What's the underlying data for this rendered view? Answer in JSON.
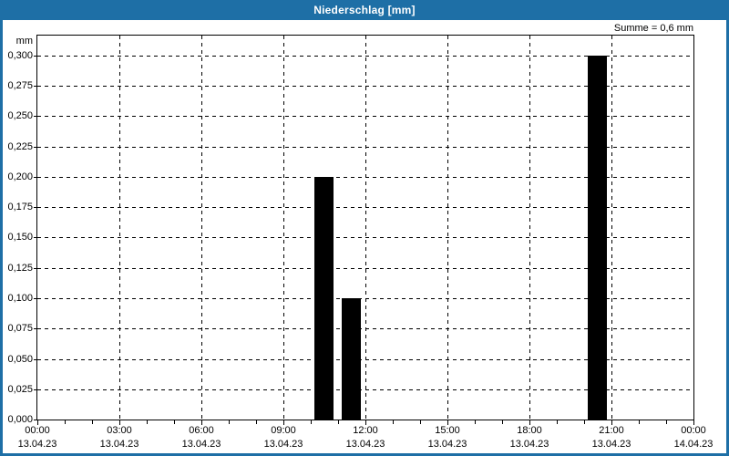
{
  "window": {
    "title": "Niederschlag [mm]"
  },
  "colors": {
    "titlebar": "#1e6fa6",
    "frame": "#1e6fa6",
    "plot_border": "#000000",
    "background": "#ffffff",
    "bar": "#000000",
    "title_text": "#ffffff"
  },
  "chart_data": {
    "type": "bar",
    "title": "Niederschlag [mm]",
    "ylabel": "mm",
    "xlabel": "",
    "sum_annotation": "Summe = 0,6 mm",
    "ylim": [
      0,
      0.3
    ],
    "ytick_step": 0.025,
    "ytick_labels": [
      "0,000",
      "0,025",
      "0,050",
      "0,075",
      "0,100",
      "0,125",
      "0,150",
      "0,175",
      "0,200",
      "0,225",
      "0,250",
      "0,275",
      "0,300"
    ],
    "x_range_hours": [
      0,
      24
    ],
    "xtick_hours": [
      0,
      3,
      6,
      9,
      12,
      15,
      18,
      21,
      24
    ],
    "xticks": [
      {
        "time": "00:00",
        "date": "13.04.23"
      },
      {
        "time": "03:00",
        "date": "13.04.23"
      },
      {
        "time": "06:00",
        "date": "13.04.23"
      },
      {
        "time": "09:00",
        "date": "13.04.23"
      },
      {
        "time": "12:00",
        "date": "13.04.23"
      },
      {
        "time": "15:00",
        "date": "13.04.23"
      },
      {
        "time": "18:00",
        "date": "13.04.23"
      },
      {
        "time": "21:00",
        "date": "13.04.23"
      },
      {
        "time": "00:00",
        "date": "14.04.23"
      }
    ],
    "minor_xtick_every_hours": 1,
    "grid": "dashed",
    "legend": null,
    "series": [
      {
        "name": "Niederschlag",
        "unit": "mm",
        "bars": [
          {
            "interval": "10:00-11:00",
            "start_hour": 10,
            "end_hour": 11,
            "value_mm": 0.2
          },
          {
            "interval": "11:00-12:00",
            "start_hour": 11,
            "end_hour": 12,
            "value_mm": 0.1
          },
          {
            "interval": "20:00-21:00",
            "start_hour": 20,
            "end_hour": 21,
            "value_mm": 0.3
          }
        ]
      }
    ]
  }
}
